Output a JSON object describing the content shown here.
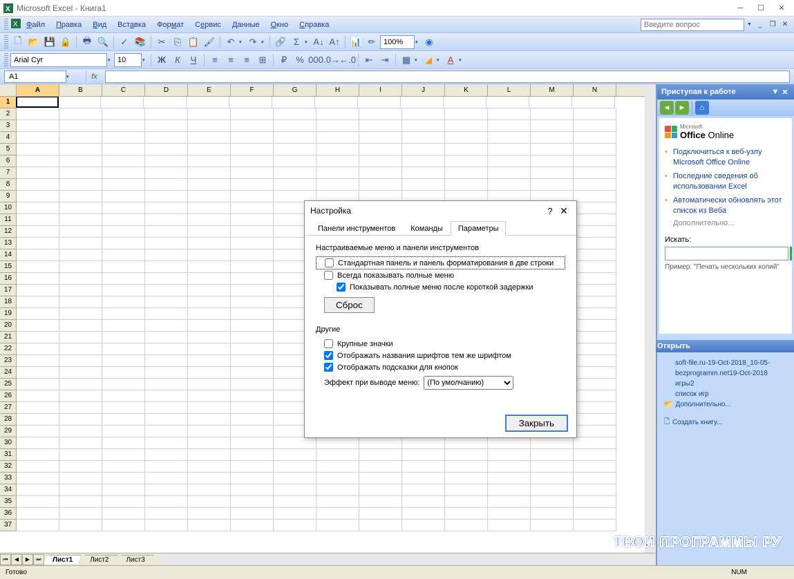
{
  "window": {
    "title": "Microsoft Excel - Книга1"
  },
  "menu": {
    "items": [
      "Файл",
      "Правка",
      "Вид",
      "Вставка",
      "Формат",
      "Сервис",
      "Данные",
      "Окно",
      "Справка"
    ],
    "ask_placeholder": "Введите вопрос"
  },
  "toolbar2": {
    "font_name": "Arial Cyr",
    "font_size": "10",
    "zoom": "100%"
  },
  "formula": {
    "cell_ref": "A1",
    "fx": "fx"
  },
  "columns": [
    "A",
    "B",
    "C",
    "D",
    "E",
    "F",
    "G",
    "H",
    "I",
    "J",
    "K",
    "L",
    "M",
    "N"
  ],
  "row_count": 37,
  "active_cell": {
    "row": 1,
    "col": "A"
  },
  "sheets": {
    "active": "Лист1",
    "tabs": [
      "Лист1",
      "Лист2",
      "Лист3"
    ]
  },
  "status": {
    "ready": "Готово",
    "num": "NUM"
  },
  "taskpane": {
    "title": "Приступая к работе",
    "office_brand_small": "Microsoft",
    "office_brand": "Office Online",
    "links": [
      "Подключиться к веб-узлу Microsoft Office Online",
      "Последние сведения об использовании Excel",
      "Автоматически обновлять этот список из Веба"
    ],
    "more": "Дополнительно...",
    "search_label": "Искать:",
    "example": "Пример: \"Печать нескольких копий\"",
    "open_header": "Открыть",
    "files": [
      "soft-file.ru-19-Oct-2018_10-05-",
      "bezprogramm.net19-Oct-2018",
      "игры2",
      "список игр"
    ],
    "folder_more": "Дополнительно...",
    "create": "Создать книгу..."
  },
  "dialog": {
    "title": "Настройка",
    "tabs": [
      "Панели инструментов",
      "Команды",
      "Параметры"
    ],
    "active_tab": "Параметры",
    "group1_title": "Настраиваемые меню и панели инструментов",
    "chk_two_rows": "Стандартная панель и панель форматирования в две строки",
    "chk_full_menus": "Всегда показывать полные меню",
    "chk_delay": "Показывать полные меню после короткой задержки",
    "reset": "Сброс",
    "group2_title": "Другие",
    "chk_large": "Крупные значки",
    "chk_font_names": "Отображать названия шрифтов тем же шрифтом",
    "chk_tooltips": "Отображать подсказки для кнопок",
    "effect_label": "Эффект при выводе меню:",
    "effect_value": "(По умолчанию)",
    "close": "Закрыть"
  },
  "watermark": "ТВОИ ПРОГРАММЫ РУ"
}
